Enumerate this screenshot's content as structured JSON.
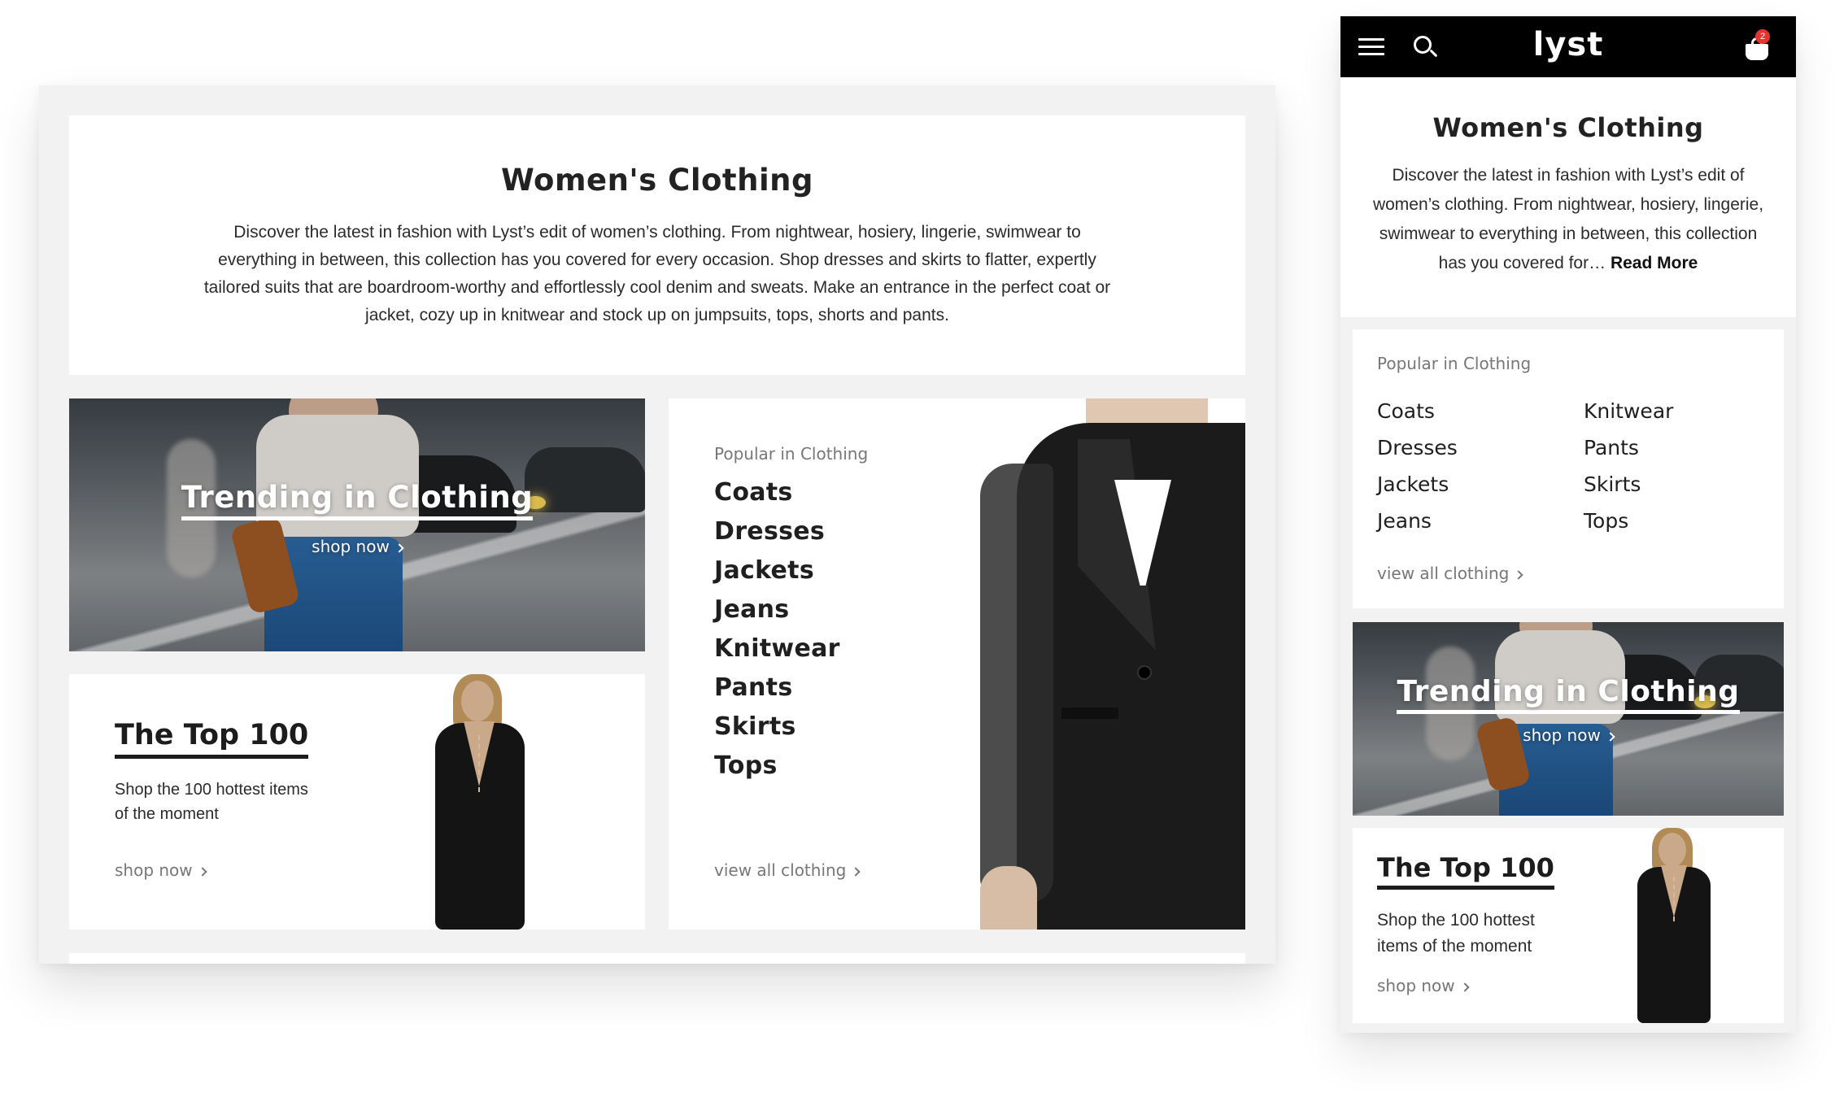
{
  "desktop": {
    "intro": {
      "title": "Women's Clothing",
      "description": "Discover the latest in fashion with Lyst’s edit of women’s clothing. From nightwear, hosiery, lingerie, swimwear to everything in between, this collection has you covered for every occasion. Shop dresses and skirts to flatter, expertly tailored suits that are boardroom-worthy and effortlessly cool denim and sweats. Make an entrance in the perfect coat or jacket, cozy up in knitwear and stock up on jumpsuits, tops, shorts and pants."
    },
    "trending": {
      "title": "Trending in Clothing",
      "cta": "shop now"
    },
    "top100": {
      "title": "The Top 100",
      "description": "Shop the 100 hottest items of the moment",
      "cta": "shop now"
    },
    "popular": {
      "label": "Popular in Clothing",
      "items": [
        "Coats",
        "Dresses",
        "Jackets",
        "Jeans",
        "Knitwear",
        "Pants",
        "Skirts",
        "Tops"
      ],
      "view_all": "view all clothing"
    }
  },
  "mobile": {
    "nav": {
      "logo": "lyst",
      "cart_count": "2",
      "icons": [
        "menu-icon",
        "search-icon",
        "shopping-bag-icon"
      ]
    },
    "intro": {
      "title": "Women's Clothing",
      "description": "Discover the latest in fashion with Lyst’s edit of women’s clothing. From nightwear, hosiery, lingerie, swimwear to everything in between, this collection has you covered for…",
      "read_more": "Read More"
    },
    "popular": {
      "label": "Popular in Clothing",
      "col1": [
        "Coats",
        "Dresses",
        "Jackets",
        "Jeans"
      ],
      "col2": [
        "Knitwear",
        "Pants",
        "Skirts",
        "Tops"
      ],
      "view_all": "view all clothing"
    },
    "trending": {
      "title": "Trending in Clothing",
      "cta": "shop now"
    },
    "top100": {
      "title": "The Top 100",
      "description": "Shop the 100 hottest items of the moment",
      "cta": "shop now"
    }
  },
  "colors": {
    "nav_bg": "#000000",
    "panel_bg": "#f2f2f2",
    "badge": "#e8332e",
    "muted_text": "#777777"
  }
}
